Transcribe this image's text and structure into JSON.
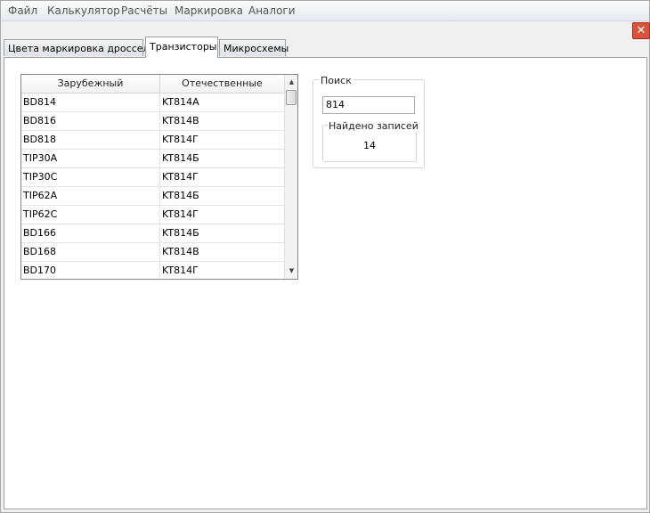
{
  "menu": [
    "Файл",
    "Калькулятор",
    "Расчёты",
    "Маркировка",
    "Аналоги"
  ],
  "tabs": [
    "Цвета маркировка дросселя",
    "Транзисторы",
    "Микросхемы"
  ],
  "active_tab": 1,
  "close_icon": "close-icon",
  "table": {
    "columns": [
      "Зарубежный",
      "Отечественные"
    ],
    "rows": [
      [
        "BD814",
        "KT814A"
      ],
      [
        "BD816",
        "KT814B"
      ],
      [
        "BD818",
        "KT814Г"
      ],
      [
        "TIP30A",
        "KT814Б"
      ],
      [
        "TIP30C",
        "KT814Г"
      ],
      [
        "TIP62A",
        "KT814Б"
      ],
      [
        "TIP62C",
        "KT814Г"
      ],
      [
        "BD166",
        "KT814Б"
      ],
      [
        "BD168",
        "KT814B"
      ],
      [
        "BD170",
        "KT814Г"
      ]
    ]
  },
  "search": {
    "title": "Поиск",
    "value": "814",
    "found_title": "Найдено записей",
    "found_count": "14"
  }
}
